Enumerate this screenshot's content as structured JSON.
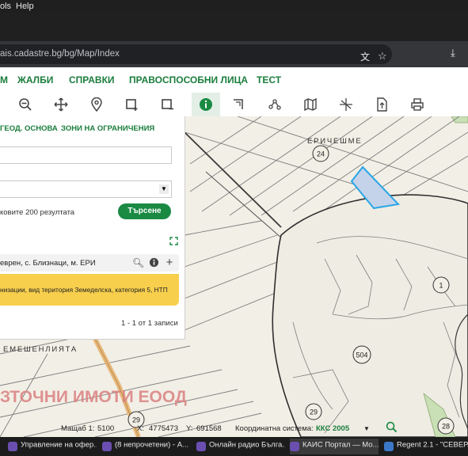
{
  "browser": {
    "menu": [
      "ols",
      "Help"
    ],
    "url": "ais.cadastre.bg/bg/Map/Index"
  },
  "nav": [
    "М",
    "ЖАЛБИ",
    "СПРАВКИ",
    "ПРАВОСПОСОБНИ ЛИЦА",
    "ТЕСТ"
  ],
  "toolbar": {
    "tools": [
      "zoom-out",
      "pan",
      "location",
      "select-rect",
      "select-area",
      "info",
      "measure-area",
      "measure-line",
      "map-layers",
      "coordinates",
      "upload",
      "print"
    ]
  },
  "panel": {
    "tabs": [
      "ГЕОД. ОСНОВА",
      "ЗОНИ НА ОГРАНИЧЕНИЯ"
    ],
    "limit_text": "ковите 200 резултата",
    "search_button": "Търсене",
    "result_text": "еврен, с. Близнаци, м. ЕРИ",
    "detail_text": "низации, вид територия Земеделска, категория 5, НТП",
    "count_text": "1 - 1 от 1 записи"
  },
  "map": {
    "labels": {
      "locality_1": "ЕРИЧЕШМЕ",
      "locality_2": "ЕМЕШЕНЛИЯТА",
      "watermark": "ЗТОЧНИ ИМОТИ ЕООД"
    },
    "parcel_numbers": [
      "24",
      "1",
      "504",
      "29",
      "28",
      "29"
    ],
    "colors": {
      "background": "#f2efe6",
      "parcel_line": "#6e6e6e",
      "road": "#e8b87a",
      "selected_fill": "#c5d3ea",
      "selected_stroke": "#2aa6e6",
      "green_area": "#c9dfb5"
    }
  },
  "status": {
    "scale_label": "Мащаб 1:",
    "scale_value": "5100",
    "x_label": "X:",
    "x_value": "4775473",
    "y_label": "Y:",
    "y_value": "691568",
    "crs_label": "Координатна система:",
    "crs_value": "ККС 2005"
  },
  "taskbar": [
    {
      "label": "Управление на офер...",
      "icon": "browser-icon"
    },
    {
      "label": "(8 непрочетени) - А...",
      "icon": "browser-icon"
    },
    {
      "label": "Онлайн радио Бълга...",
      "icon": "browser-icon"
    },
    {
      "label": "КАИС Портал — Мо...",
      "icon": "browser-icon"
    },
    {
      "label": "Regent 2.1 - \"СЕВЕР...",
      "icon": "app-icon"
    }
  ]
}
